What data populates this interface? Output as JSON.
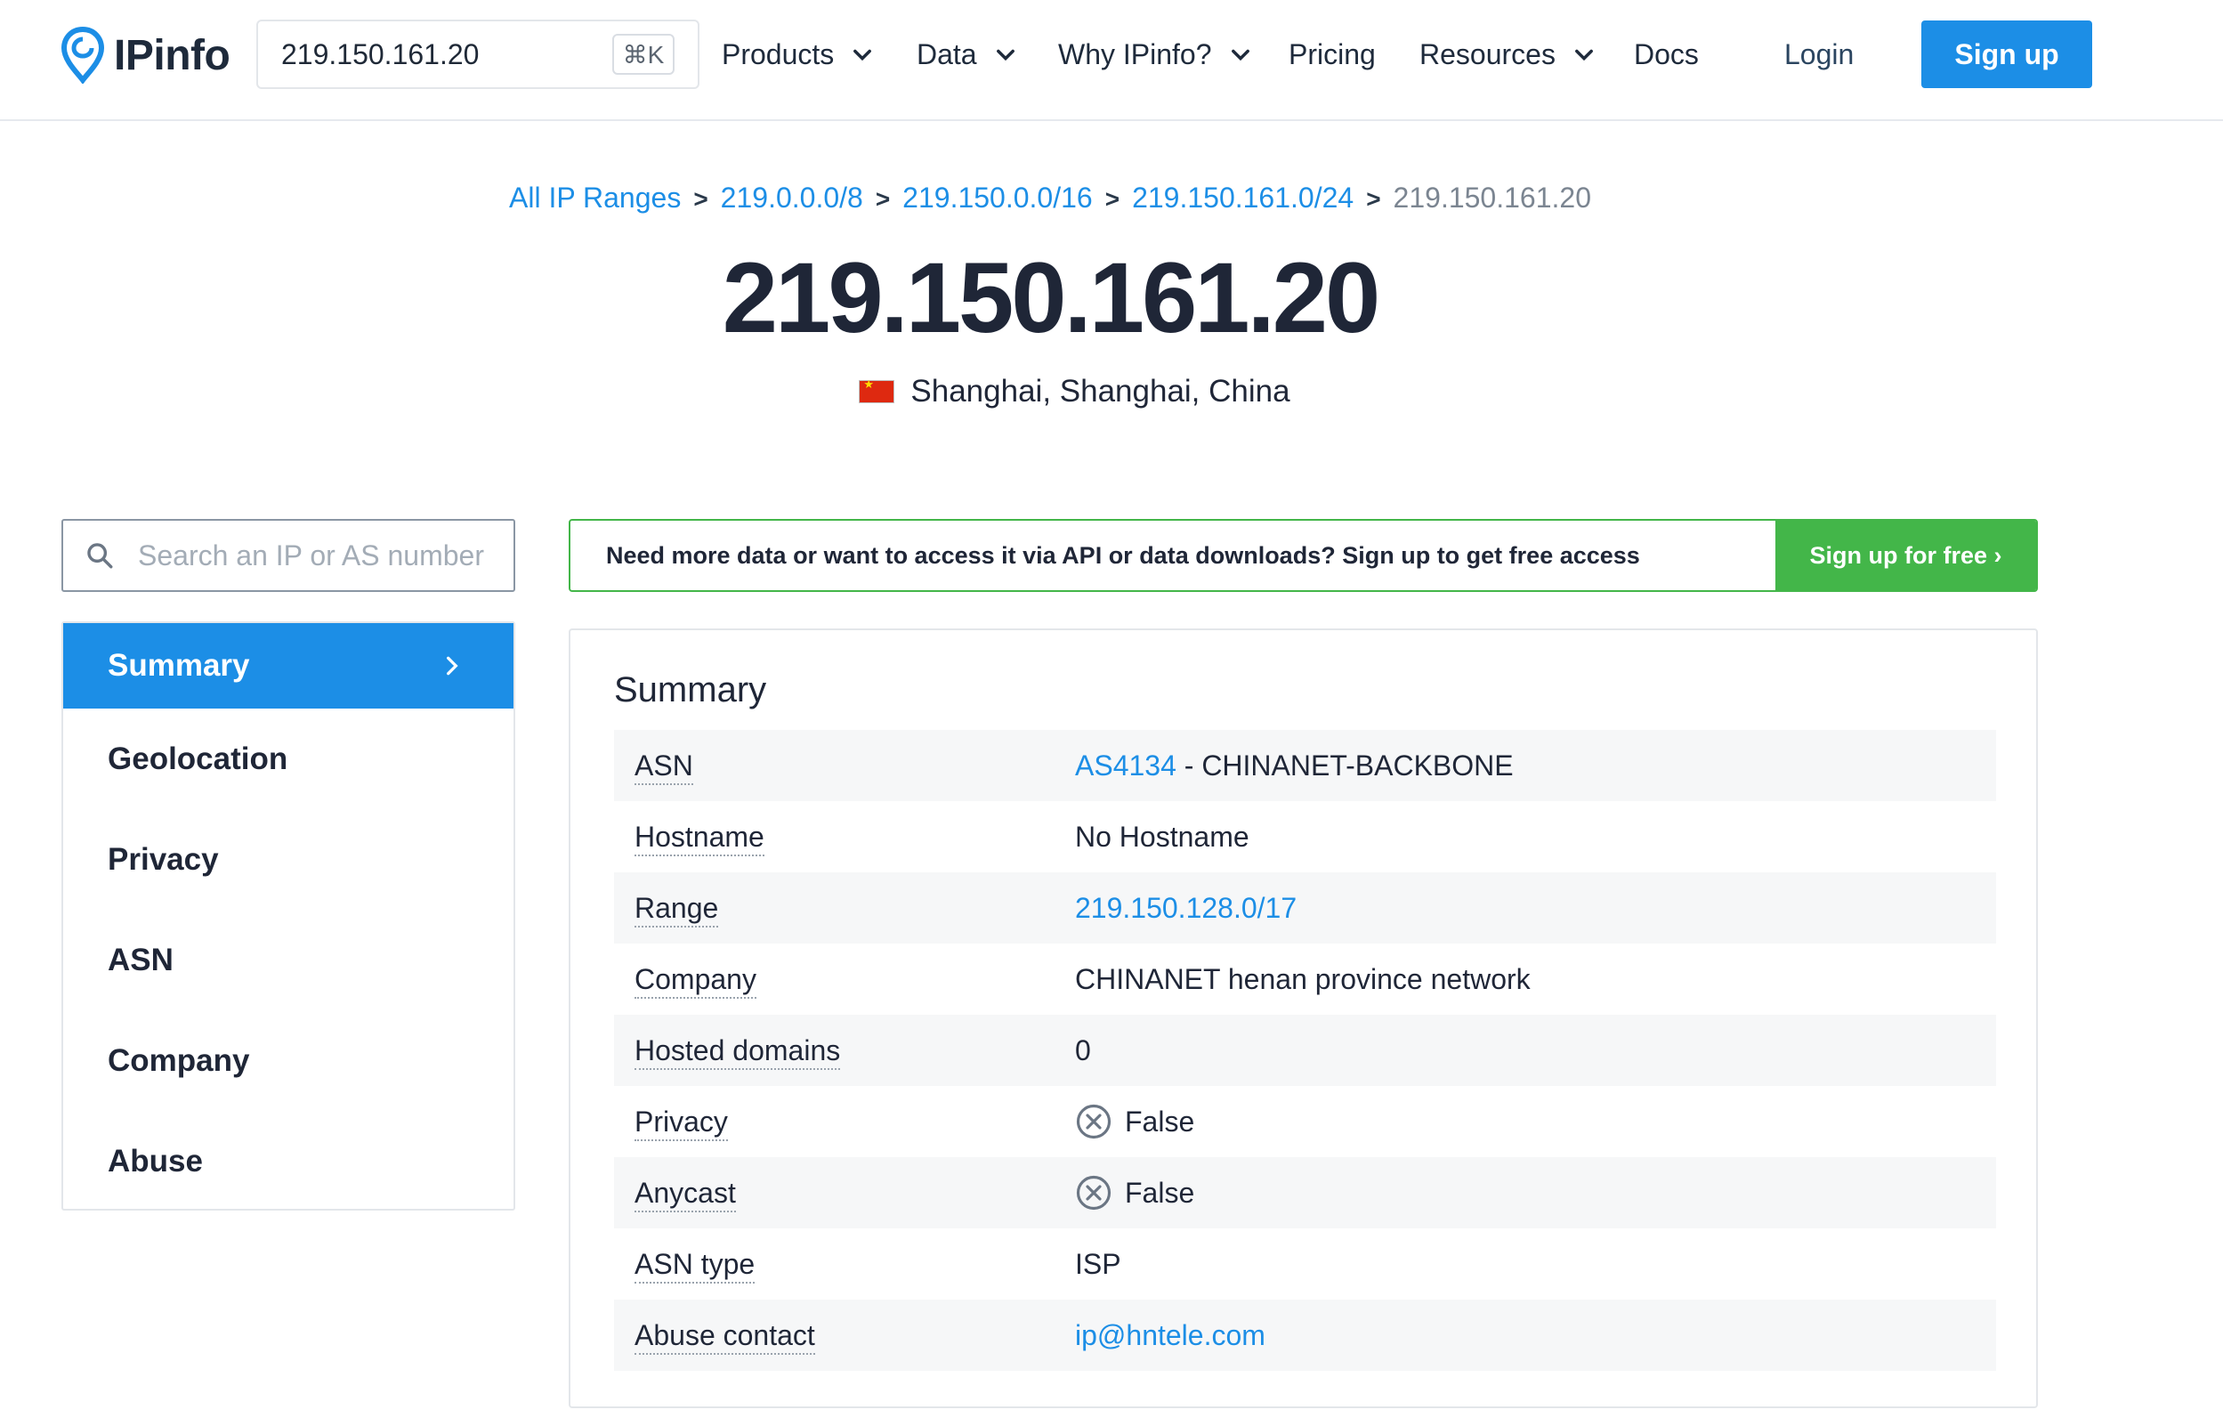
{
  "header": {
    "logo_text": "IPinfo",
    "search_value": "219.150.161.20",
    "search_shortcut": "⌘K",
    "nav": {
      "products": "Products",
      "data": "Data",
      "why": "Why IPinfo?",
      "pricing": "Pricing",
      "resources": "Resources",
      "docs": "Docs",
      "login": "Login"
    },
    "signup": "Sign up"
  },
  "breadcrumb": {
    "all": "All IP Ranges",
    "r8": "219.0.0.0/8",
    "r16": "219.150.0.0/16",
    "r24": "219.150.161.0/24",
    "current": "219.150.161.20",
    "separator": ">"
  },
  "ip_title": "219.150.161.20",
  "location": "Shanghai, Shanghai, China",
  "sidebar": {
    "search_placeholder": "Search an IP or AS number",
    "items": [
      {
        "label": "Summary"
      },
      {
        "label": "Geolocation"
      },
      {
        "label": "Privacy"
      },
      {
        "label": "ASN"
      },
      {
        "label": "Company"
      },
      {
        "label": "Abuse"
      }
    ]
  },
  "banner": {
    "text": "Need more data or want to access it via API or data downloads? Sign up to get free access",
    "button": "Sign up for free ›"
  },
  "summary": {
    "title": "Summary",
    "asn_key": "ASN",
    "asn_link": "AS4134",
    "asn_rest": " - CHINANET-BACKBONE",
    "hostname_key": "Hostname",
    "hostname_val": "No Hostname",
    "range_key": "Range",
    "range_val": "219.150.128.0/17",
    "company_key": "Company",
    "company_val": "CHINANET henan province network",
    "hosted_key": "Hosted domains",
    "hosted_val": "0",
    "privacy_key": "Privacy",
    "privacy_val": "False",
    "anycast_key": "Anycast",
    "anycast_val": "False",
    "asntype_key": "ASN type",
    "asntype_val": "ISP",
    "abuse_key": "Abuse contact",
    "abuse_val": "ip@hntele.com"
  },
  "colors": {
    "accent": "#1c8ee6",
    "banner_green": "#43b649",
    "flag_red": "#de2910"
  }
}
